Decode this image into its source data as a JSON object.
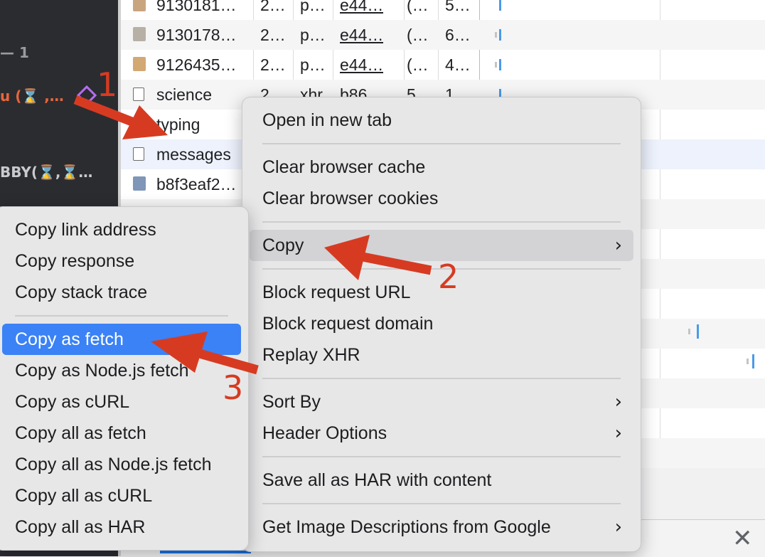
{
  "left_panel": {
    "line1": "— 1",
    "line2": "u (⌛ ,…",
    "line3": "BBY(⌛,⌛…"
  },
  "network_rows": [
    {
      "name": "9130181…",
      "c1": "2…",
      "c2": "p…",
      "c3": "e44…",
      "c4": "(…",
      "c5": "5…",
      "icon": "image"
    },
    {
      "name": "9130178…",
      "c1": "2…",
      "c2": "p…",
      "c3": "e44…",
      "c4": "(…",
      "c5": "6…",
      "icon": "image"
    },
    {
      "name": "9126435…",
      "c1": "2…",
      "c2": "p…",
      "c3": "e44…",
      "c4": "(…",
      "c5": "4…",
      "icon": "image"
    },
    {
      "name": "science",
      "c1": "2…",
      "c2": "xhr",
      "c3": "b86…",
      "c4": "5…",
      "c5": "1…",
      "icon": "document"
    },
    {
      "name": "typing",
      "icon": "document"
    },
    {
      "name": "messages",
      "icon": "document"
    },
    {
      "name": "b8f3eaf2…",
      "icon": "image"
    }
  ],
  "context_menu": {
    "items": [
      {
        "label": "Open in new tab"
      },
      {
        "label": "Clear browser cache"
      },
      {
        "label": "Clear browser cookies"
      },
      {
        "label": "Copy",
        "submenu": true
      },
      {
        "label": "Block request URL"
      },
      {
        "label": "Block request domain"
      },
      {
        "label": "Replay XHR"
      },
      {
        "label": "Sort By",
        "submenu": true
      },
      {
        "label": "Header Options",
        "submenu": true
      },
      {
        "label": "Save all as HAR with content"
      },
      {
        "label": "Get Image Descriptions from Google",
        "submenu": true
      }
    ]
  },
  "copy_submenu": {
    "items": [
      {
        "label": "Copy link address"
      },
      {
        "label": "Copy response"
      },
      {
        "label": "Copy stack trace"
      },
      {
        "label": "Copy as fetch"
      },
      {
        "label": "Copy as Node.js fetch"
      },
      {
        "label": "Copy as cURL"
      },
      {
        "label": "Copy all as fetch"
      },
      {
        "label": "Copy all as Node.js fetch"
      },
      {
        "label": "Copy all as cURL"
      },
      {
        "label": "Copy all as HAR"
      }
    ]
  },
  "annotations": {
    "step1": "1",
    "step2": "2",
    "step3": "3"
  },
  "colors": {
    "annotation": "#d63b22",
    "highlight": "#3a82f6",
    "waterfall": "#4a9ae8",
    "left_panel_bg": "#2b2c30",
    "left_panel_accent": "#e8663c"
  }
}
